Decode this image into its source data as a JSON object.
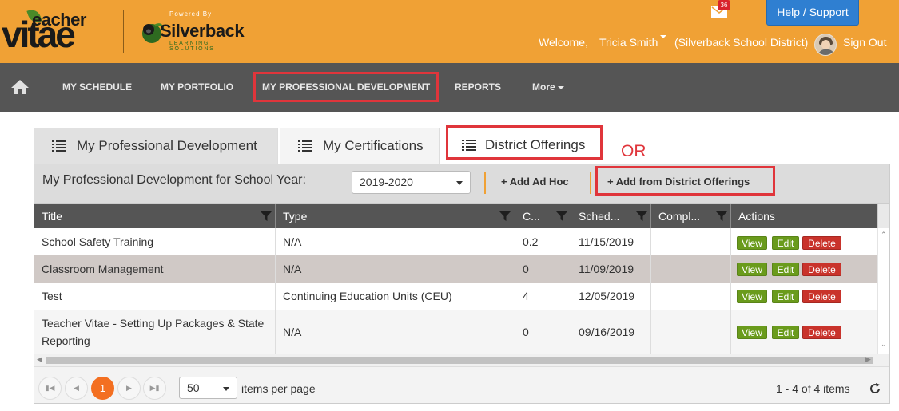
{
  "brand": {
    "logo_text_top": "eacher",
    "logo_text_main": "vitae",
    "powered_by": "Powered By",
    "partner_name": "Silverback",
    "partner_sub": "LEARNING SOLUTIONS"
  },
  "header": {
    "mail_count": "36",
    "help_label": "Help / Support",
    "welcome": "Welcome,",
    "user_name": "Tricia Smith",
    "district": "(Silverback School District)",
    "sign_out": "Sign Out"
  },
  "nav": {
    "items": [
      {
        "label": "MY SCHEDULE"
      },
      {
        "label": "MY PORTFOLIO"
      },
      {
        "label": "MY PROFESSIONAL DEVELOPMENT"
      },
      {
        "label": "REPORTS"
      },
      {
        "label": "More"
      }
    ]
  },
  "tabs": [
    {
      "label": "My Professional Development"
    },
    {
      "label": "My Certifications"
    },
    {
      "label": "District Offerings"
    }
  ],
  "annotation": {
    "or": "OR"
  },
  "toolbar": {
    "title": "My Professional Development for School Year:",
    "school_year": "2019-2020",
    "add_ad_hoc": "+ Add Ad Hoc",
    "add_from_district": "+ Add from District Offerings"
  },
  "grid": {
    "columns": [
      "Title",
      "Type",
      "C...",
      "Sched...",
      "Compl...",
      "Actions"
    ],
    "rows": [
      {
        "title": "School Safety Training",
        "type": "N/A",
        "credits": "0.2",
        "scheduled": "11/15/2019",
        "completed": ""
      },
      {
        "title": "Classroom Management",
        "type": "N/A",
        "credits": "0",
        "scheduled": "11/09/2019",
        "completed": ""
      },
      {
        "title": "Test",
        "type": "Continuing Education Units (CEU)",
        "credits": "4",
        "scheduled": "12/05/2019",
        "completed": ""
      },
      {
        "title": "Teacher Vitae - Setting Up Packages & State Reporting",
        "type": "N/A",
        "credits": "0",
        "scheduled": "09/16/2019",
        "completed": ""
      }
    ],
    "actions": {
      "view": "View",
      "edit": "Edit",
      "delete": "Delete"
    }
  },
  "pager": {
    "current_page": "1",
    "page_size": "50",
    "per_page_label": "items per page",
    "summary": "1 - 4 of 4 items"
  },
  "colors": {
    "header_bg": "#f0a135",
    "nav_bg": "#555555",
    "highlight": "#e0353b",
    "help_button": "#2f7fd1",
    "view_edit_button": "#6a9b1c",
    "delete_button": "#c9332b",
    "active_page": "#f36f21"
  }
}
